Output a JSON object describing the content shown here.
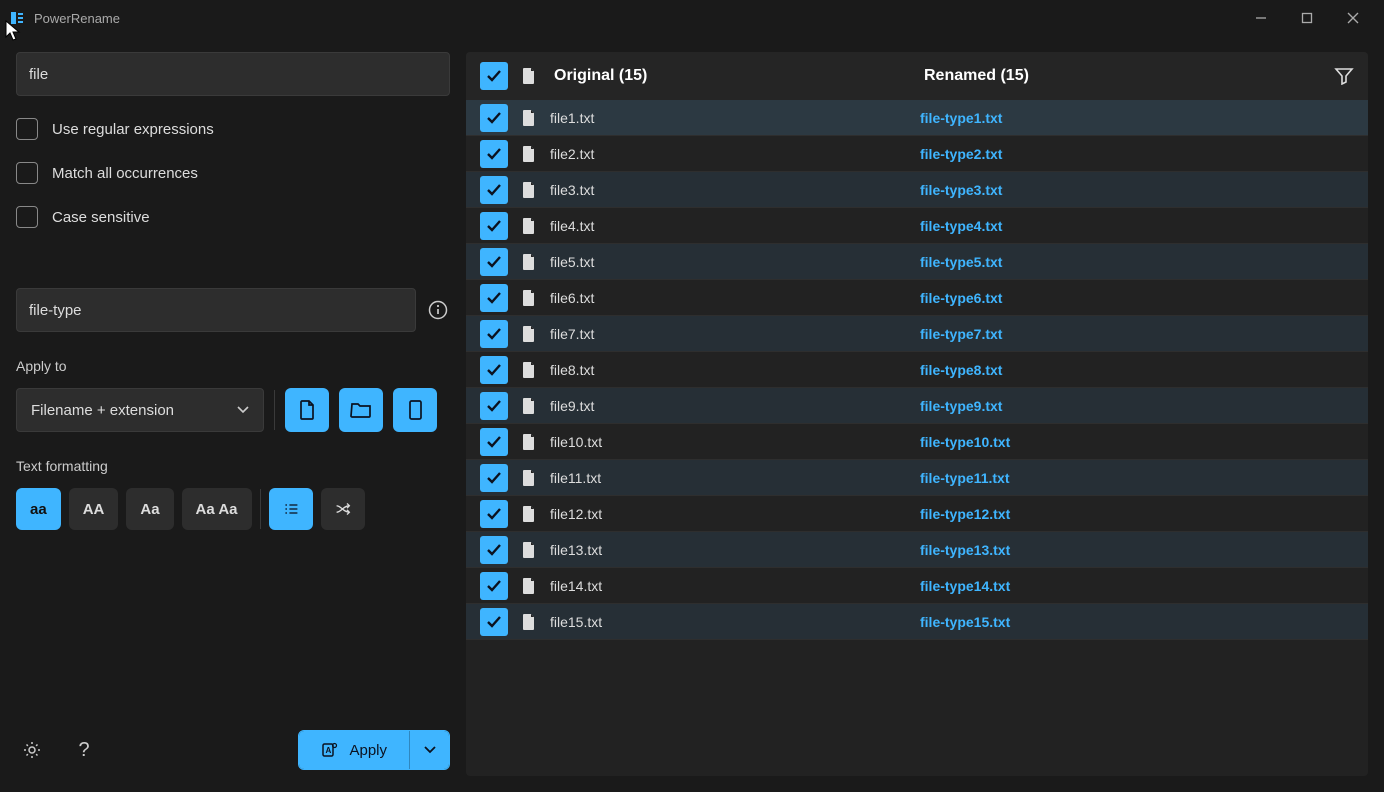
{
  "window": {
    "title": "PowerRename"
  },
  "search": {
    "value": "file",
    "options": {
      "regex": "Use regular expressions",
      "matchAll": "Match all occurrences",
      "caseSensitive": "Case sensitive"
    }
  },
  "replace": {
    "value": "file-type"
  },
  "applyTo": {
    "label": "Apply to",
    "selected": "Filename + extension"
  },
  "textFormatting": {
    "label": "Text formatting",
    "buttons": {
      "aa": "aa",
      "AA": "AA",
      "Aa": "Aa",
      "AaAa": "Aa Aa"
    }
  },
  "apply": {
    "label": "Apply"
  },
  "list": {
    "originalHeader": "Original (15)",
    "renamedHeader": "Renamed (15)",
    "items": [
      {
        "orig": "file1.txt",
        "ren": "file-type1.txt"
      },
      {
        "orig": "file2.txt",
        "ren": "file-type2.txt"
      },
      {
        "orig": "file3.txt",
        "ren": "file-type3.txt"
      },
      {
        "orig": "file4.txt",
        "ren": "file-type4.txt"
      },
      {
        "orig": "file5.txt",
        "ren": "file-type5.txt"
      },
      {
        "orig": "file6.txt",
        "ren": "file-type6.txt"
      },
      {
        "orig": "file7.txt",
        "ren": "file-type7.txt"
      },
      {
        "orig": "file8.txt",
        "ren": "file-type8.txt"
      },
      {
        "orig": "file9.txt",
        "ren": "file-type9.txt"
      },
      {
        "orig": "file10.txt",
        "ren": "file-type10.txt"
      },
      {
        "orig": "file11.txt",
        "ren": "file-type11.txt"
      },
      {
        "orig": "file12.txt",
        "ren": "file-type12.txt"
      },
      {
        "orig": "file13.txt",
        "ren": "file-type13.txt"
      },
      {
        "orig": "file14.txt",
        "ren": "file-type14.txt"
      },
      {
        "orig": "file15.txt",
        "ren": "file-type15.txt"
      }
    ]
  }
}
